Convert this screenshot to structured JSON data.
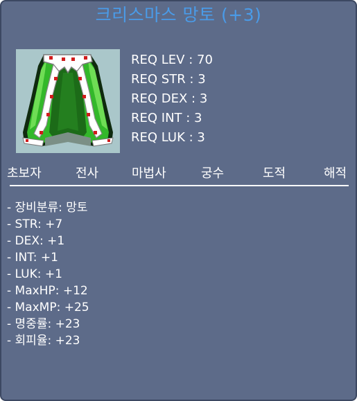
{
  "item": {
    "name": "크리스마스 망토  (+3)",
    "icon": "christmas-cape-icon"
  },
  "requirements": [
    "REQ LEV : 70",
    "REQ STR : 3",
    "REQ DEX : 3",
    "REQ INT : 3",
    "REQ LUK : 3"
  ],
  "jobs": [
    "초보자",
    "전사",
    "마법사",
    "궁수",
    "도적",
    "해적"
  ],
  "stats": [
    "- 장비분류: 망토",
    "- STR: +7",
    "- DEX: +1",
    "- INT: +1",
    "- LUK: +1",
    "- MaxHP: +12",
    "- MaxMP: +25",
    "- 명중률: +23",
    "- 회피율: +23"
  ],
  "colors": {
    "background": "#5d6b89",
    "title": "#4a9be8",
    "text": "#ffffff",
    "icon_background": "#aac7ca",
    "cape_green": "#33b82a",
    "cape_dark": "#1c6b18"
  }
}
